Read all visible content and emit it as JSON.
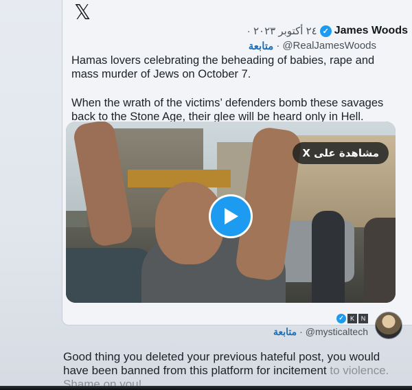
{
  "app": {
    "logo_char": "𝕏"
  },
  "tweet": {
    "author_name": "James Woods",
    "date": "٢٤ أكتوبر ٢٠٢٣ ·",
    "handle": "@RealJamesWoods",
    "follow_label": "متابعة",
    "separator": "·",
    "paragraph_1": "Hamas lovers celebrating the beheading of babies, rape and mass murder of Jews on October 7.",
    "paragraph_2": "When the wrath of the victims’ defenders bomb these savages back to the Stone Age, their glee will be heard only in Hell.",
    "watch_on_x_label": "مشاهدة على X",
    "verified_icon": "verified-badge"
  },
  "reply": {
    "badge_letters": [
      "K",
      "N"
    ],
    "handle": "@mysticaltech",
    "follow_label": "متابعة",
    "separator": "·",
    "text_main": "Good thing you deleted your previous hateful post, you would have been banned from this platform for incitement ",
    "text_faded": "to violence. Shame on you!"
  },
  "colors": {
    "accent": "#1d9bf0",
    "follow": "#1d6fb8",
    "text": "#1c2228"
  }
}
